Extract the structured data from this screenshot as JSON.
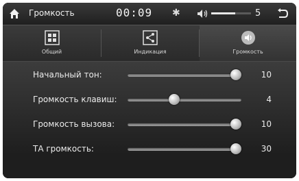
{
  "status_bar": {
    "title": "Громкость",
    "time": "00:09",
    "volume_value": "5",
    "volume_level": 0.6,
    "bluetooth_icon": "bluetooth-icon",
    "speaker_icon": "speaker-icon",
    "home_icon": "home-icon",
    "back_icon": "back-icon"
  },
  "tabs": [
    {
      "label": "Общий",
      "icon": "grid-icon",
      "active": false
    },
    {
      "label": "Индикация",
      "icon": "share-icon",
      "active": false
    },
    {
      "label": "Громкость",
      "icon": "speaker-icon",
      "active": true
    }
  ],
  "settings": [
    {
      "label": "Начальный тон:",
      "value": "10",
      "level": 1.0
    },
    {
      "label": "Громкость клавиш:",
      "value": "4",
      "level": 0.4
    },
    {
      "label": "Громкость вызова:",
      "value": "10",
      "level": 1.0
    },
    {
      "label": "ТА громкость:",
      "value": "30",
      "level": 1.0
    }
  ]
}
